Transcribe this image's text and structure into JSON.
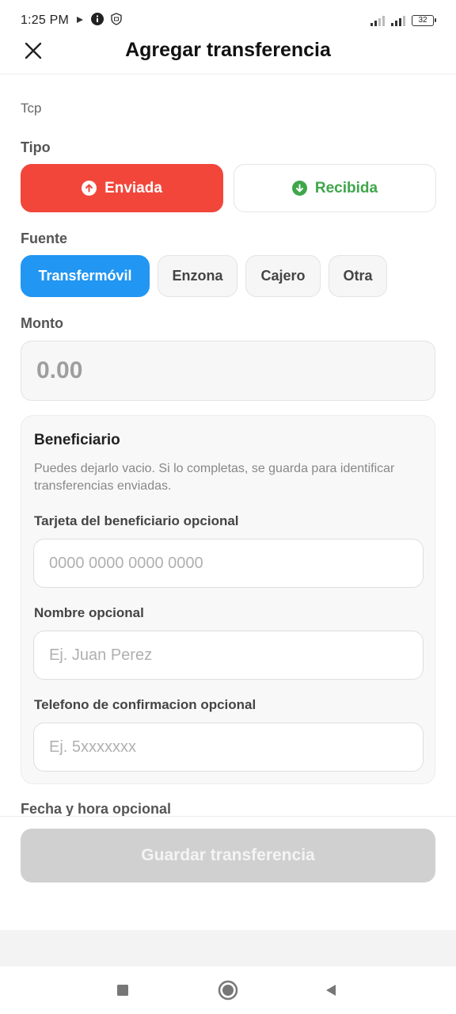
{
  "status_bar": {
    "time": "1:25 PM",
    "battery": "32"
  },
  "header": {
    "title": "Agregar transferencia",
    "close_icon": "close-icon"
  },
  "form": {
    "account": "Tcp",
    "tipo_label": "Tipo",
    "tipo_options": [
      {
        "label": "Enviada",
        "icon": "arrow-up-circle-icon",
        "color": "#f2463b",
        "selected": true
      },
      {
        "label": "Recibida",
        "icon": "arrow-down-circle-icon",
        "color": "#3fa64a",
        "selected": false
      }
    ],
    "fuente_label": "Fuente",
    "fuente_options": [
      {
        "label": "Transfermóvil",
        "selected": true
      },
      {
        "label": "Enzona",
        "selected": false
      },
      {
        "label": "Cajero",
        "selected": false
      },
      {
        "label": "Otra",
        "selected": false
      }
    ],
    "monto_label": "Monto",
    "monto_placeholder": "0.00",
    "beneficiario": {
      "title": "Beneficiario",
      "description": "Puedes dejarlo vacio. Si lo completas, se guarda para identificar transferencias enviadas.",
      "card_label": "Tarjeta del beneficiario opcional",
      "card_placeholder": "0000 0000 0000 0000",
      "name_label": "Nombre opcional",
      "name_placeholder": "Ej. Juan Perez",
      "phone_label": "Telefono de confirmacion opcional",
      "phone_placeholder": "Ej. 5xxxxxxx"
    },
    "date_label": "Fecha y hora opcional"
  },
  "actions": {
    "save_label": "Guardar transferencia"
  },
  "colors": {
    "accent_blue": "#2196f3",
    "sent_red": "#f2463b",
    "received_green": "#3fa64a",
    "disabled_gray": "#d0d0d0"
  }
}
